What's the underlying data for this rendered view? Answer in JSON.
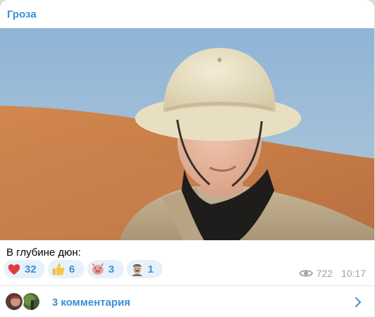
{
  "post": {
    "channel": "Гроза",
    "caption": "В глубине дюн:",
    "photo_icon": "photo-selfie-desert",
    "reactions": [
      {
        "emoji": "red-heart",
        "count": "32"
      },
      {
        "emoji": "thumbs-up",
        "count": "6"
      },
      {
        "emoji": "pig-face-sticker",
        "count": "3"
      },
      {
        "emoji": "mustached-man-sticker",
        "count": "1"
      }
    ],
    "views": "722",
    "time": "10:17",
    "comments_label": "3 комментария"
  },
  "colors": {
    "accent": "#3a8fd6",
    "reaction_bg": "#e6f1fb",
    "meta": "#9aa4ae",
    "background": "#d7e3cf"
  }
}
